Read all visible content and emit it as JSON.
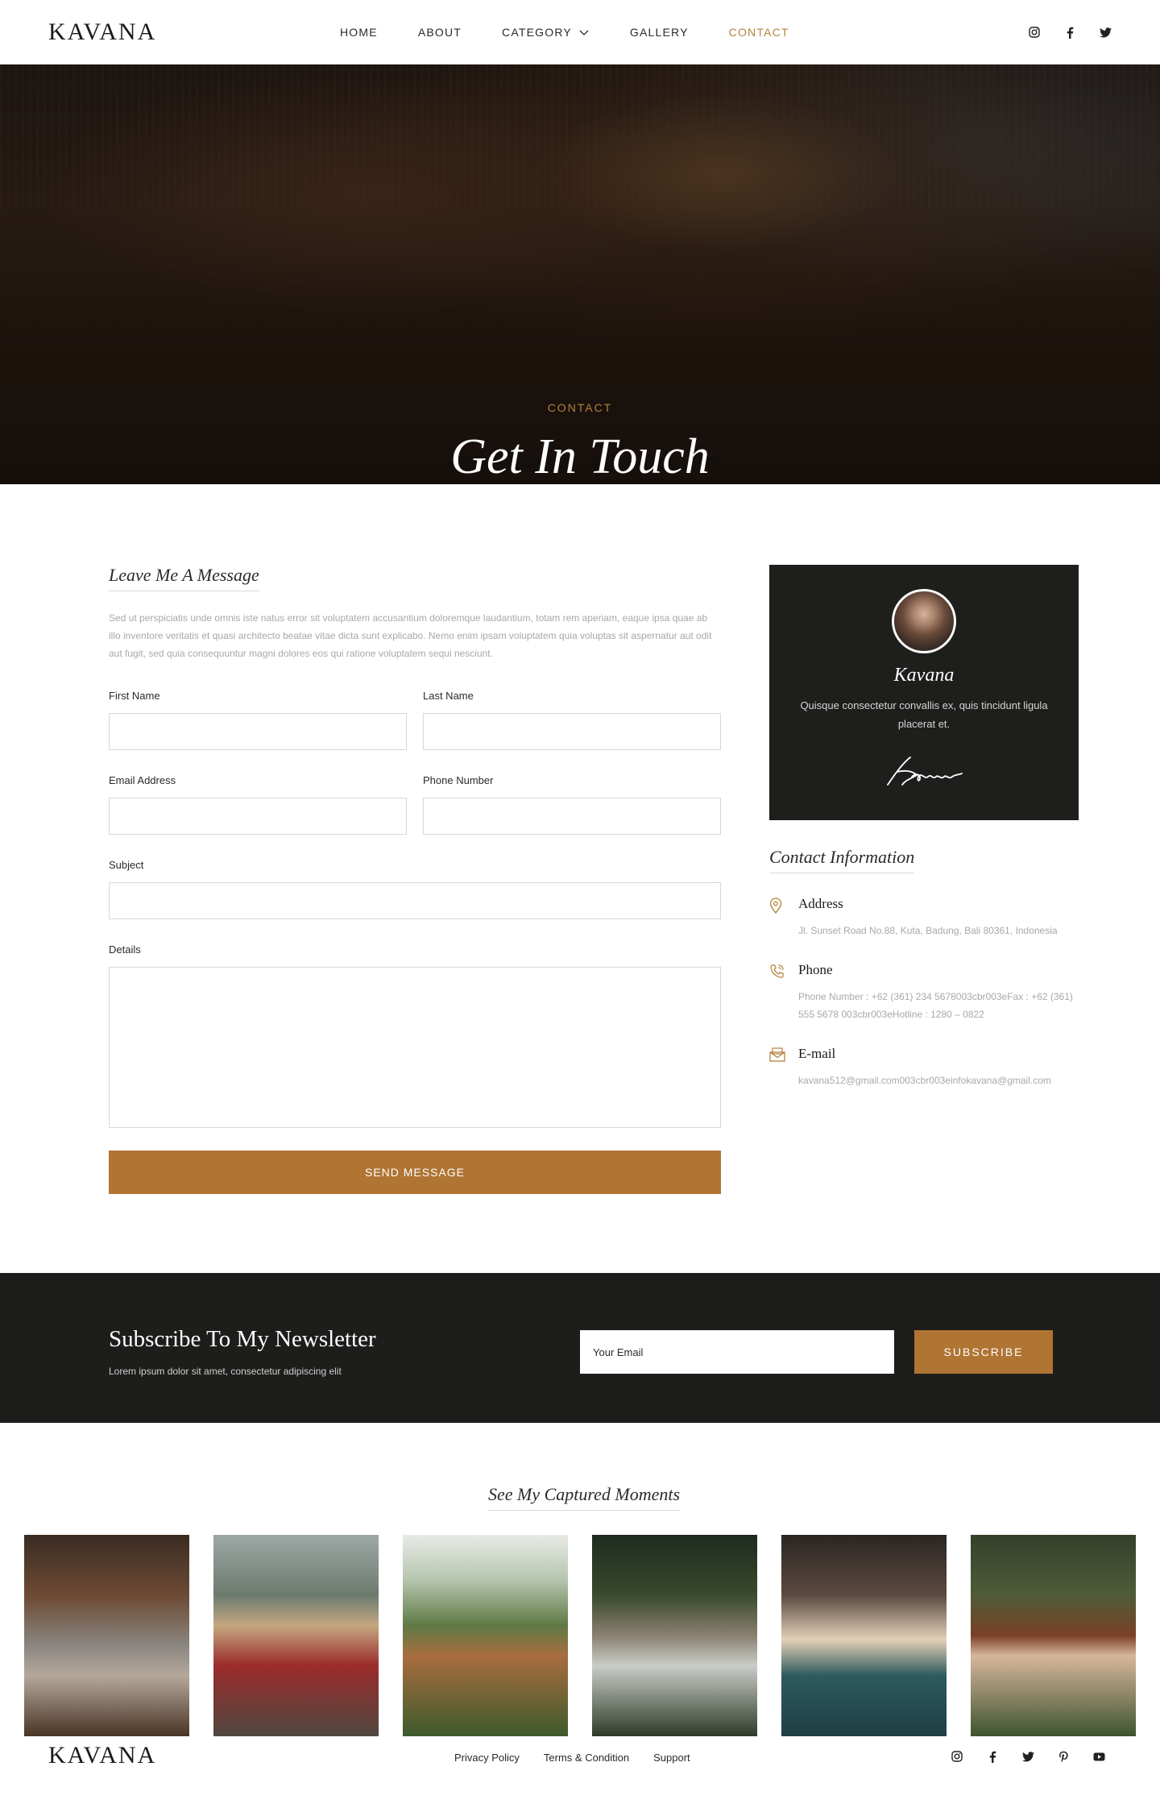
{
  "header": {
    "logo": "KAVANA",
    "nav": [
      {
        "label": "HOME"
      },
      {
        "label": "ABOUT"
      },
      {
        "label": "CATEGORY"
      },
      {
        "label": "GALLERY"
      },
      {
        "label": "CONTACT"
      }
    ],
    "social_icons": [
      "instagram-icon",
      "facebook-icon",
      "twitter-icon"
    ]
  },
  "hero": {
    "tag": "CONTACT",
    "title": "Get In Touch"
  },
  "form": {
    "heading": "Leave Me A Message",
    "intro": "Sed ut perspiciatis unde omnis iste natus error sit voluptatem accusantium doloremque laudantium, totam rem aperiam, eaque ipsa quae ab illo inventore veritatis et quasi architecto beatae vitae dicta sunt explicabo. Nemo enim ipsam voluptatem quia voluptas sit aspernatur aut odit aut fugit, sed quia consequuntur magni dolores eos qui ratione voluptatem sequi nesciunt.",
    "first_name_label": "First Name",
    "last_name_label": "Last Name",
    "email_label": "Email Address",
    "phone_label": "Phone Number",
    "subject_label": "Subject",
    "details_label": "Details",
    "send_label": "SEND MESSAGE"
  },
  "profile_card": {
    "name": "Kavana",
    "text": "Quisque consectetur convallis ex, quis tincidunt ligula placerat et.",
    "signature": "Kavana"
  },
  "contact_info": {
    "heading": "Contact Information",
    "items": [
      {
        "title": "Address",
        "value": "Jl. Sunset Road No.88, Kuta, Badung, Bali 80361, Indonesia",
        "icon": "map-pin-icon"
      },
      {
        "title": "Phone",
        "value": "Phone Number : +62 (361) 234 5678003cbr003eFax : +62 (361) 555 5678 003cbr003eHotline : 1280 – 0822",
        "icon": "phone-icon"
      },
      {
        "title": "E-mail",
        "value": "kavana512@gmail.com003cbr003einfokavana@gmail.com",
        "icon": "envelope-icon"
      }
    ]
  },
  "newsletter": {
    "title": "Subscribe To My Newsletter",
    "subtitle": "Lorem ipsum dolor sit amet, consectetur adipiscing elit",
    "email_placeholder": "Your Email",
    "button": "SUBSCRIBE"
  },
  "moments": {
    "heading": "See My Captured Moments"
  },
  "footer": {
    "logo": "KAVANA",
    "links": [
      "Privacy Policy",
      "Terms & Condition",
      "Support"
    ],
    "social_icons": [
      "instagram-icon",
      "facebook-icon",
      "twitter-icon",
      "pinterest-icon",
      "youtube-icon"
    ]
  },
  "colors": {
    "accent": "#b07433",
    "dark": "#1d1d1b"
  }
}
